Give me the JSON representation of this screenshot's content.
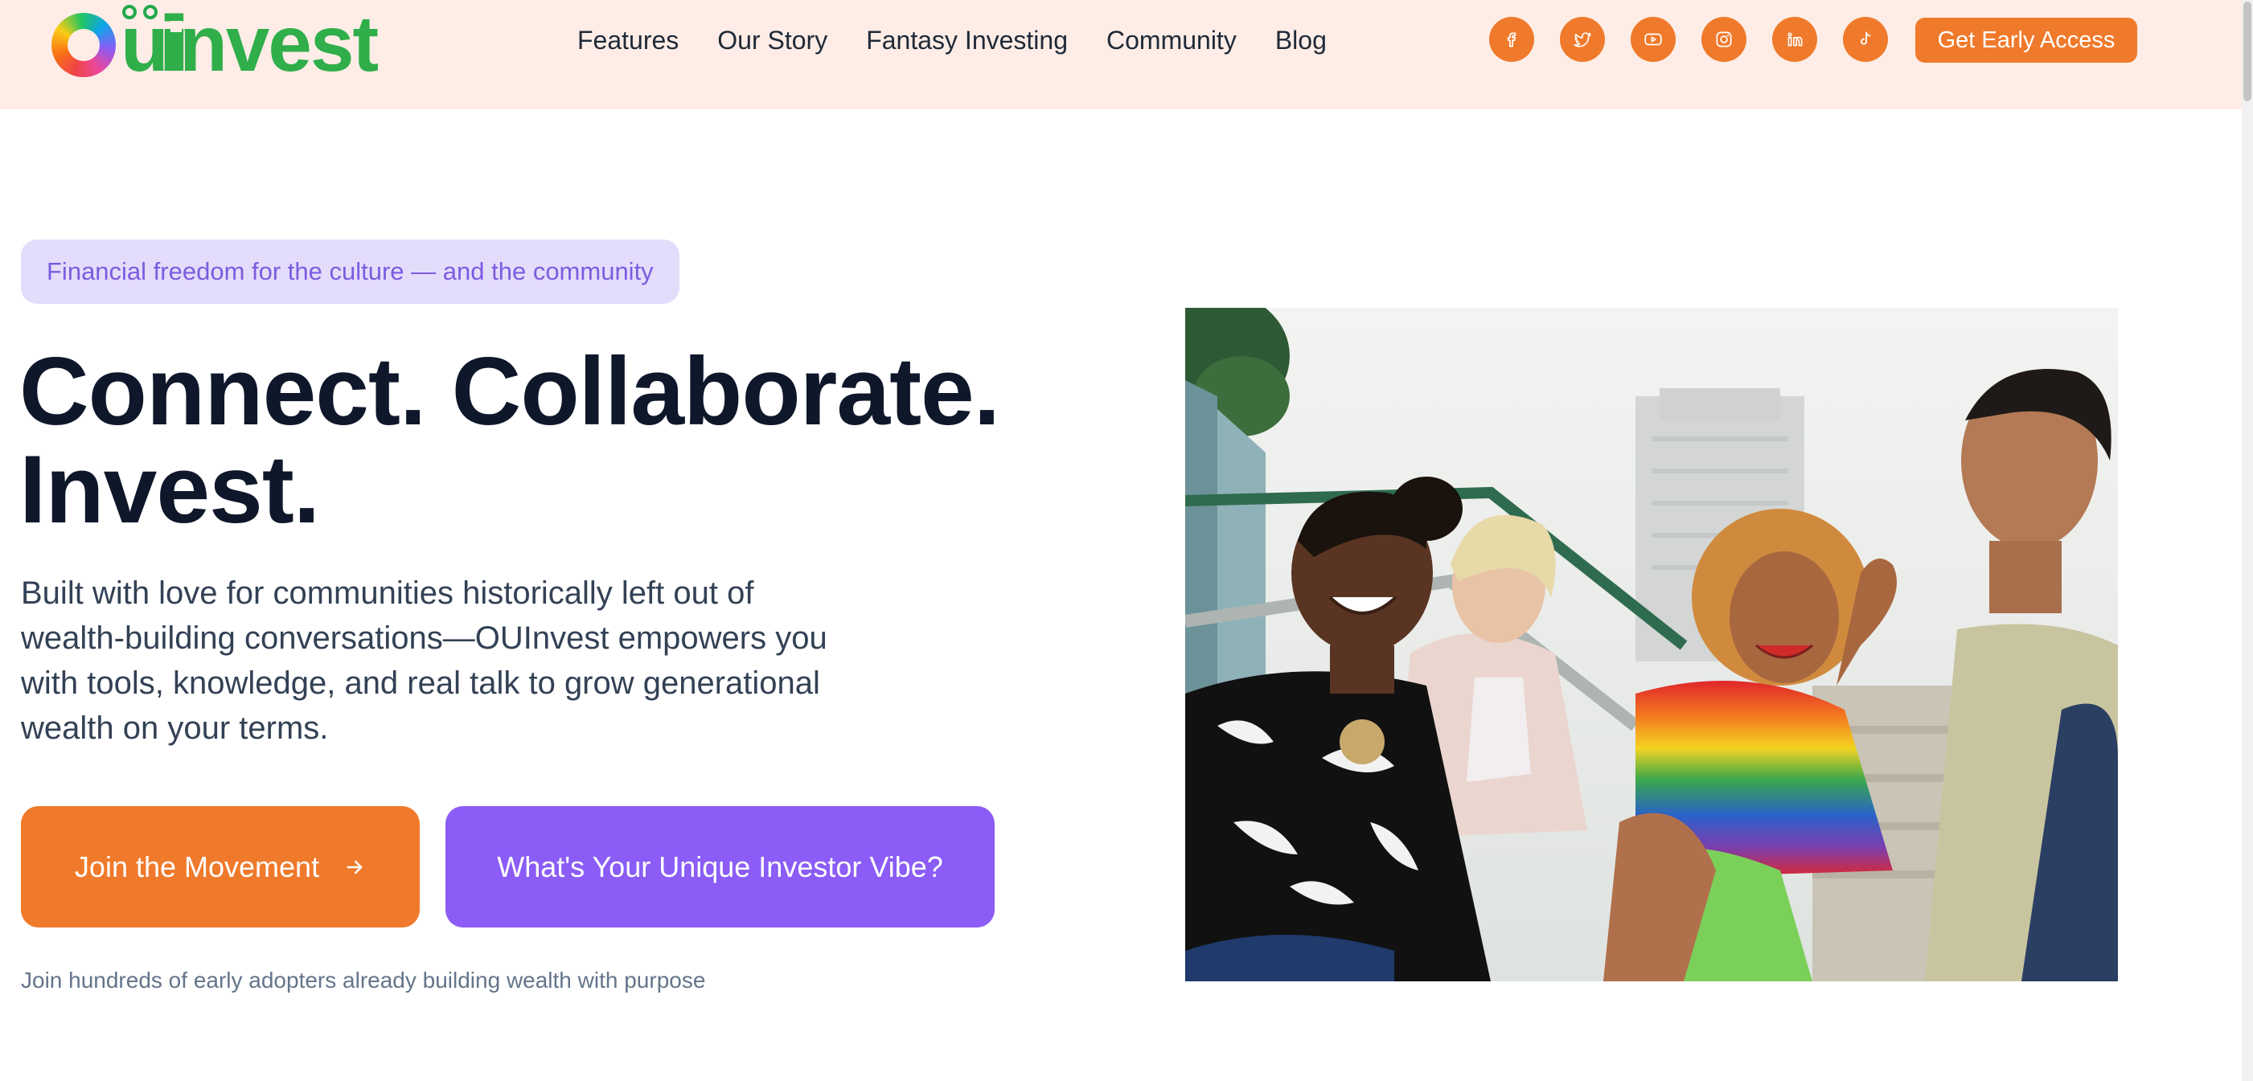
{
  "brand": {
    "logo_text": "invest",
    "logo_letters": "OU",
    "brand_color": "#2fae4a",
    "accent": "#f07a2b",
    "purple": "#8b5cf6"
  },
  "nav": {
    "items": [
      {
        "label": "Features"
      },
      {
        "label": "Our Story"
      },
      {
        "label": "Fantasy Investing"
      },
      {
        "label": "Community"
      },
      {
        "label": "Blog"
      }
    ]
  },
  "socials": [
    {
      "icon": "facebook-icon"
    },
    {
      "icon": "twitter-icon"
    },
    {
      "icon": "youtube-icon"
    },
    {
      "icon": "instagram-icon"
    },
    {
      "icon": "linkedin-icon"
    },
    {
      "icon": "tiktok-icon"
    }
  ],
  "header": {
    "cta_label": "Get Early Access"
  },
  "hero": {
    "pill": "Financial freedom for the culture — and the community",
    "title_line1": "Connect. Collaborate.",
    "title_line2": "Invest.",
    "lead": "Built with love for communities historically left out of wealth-building conversations—OUInvest empowers you with tools, knowledge, and real talk to grow generational wealth on your terms.",
    "primary_cta": "Join the Movement",
    "primary_cta_icon": "arrow-right-icon",
    "secondary_cta": "What's Your Unique Investor Vibe?",
    "footnote": "Join hundreds of early adopters already building wealth with purpose",
    "image_subject": "group-of-four-friends-laughing-outdoors"
  }
}
